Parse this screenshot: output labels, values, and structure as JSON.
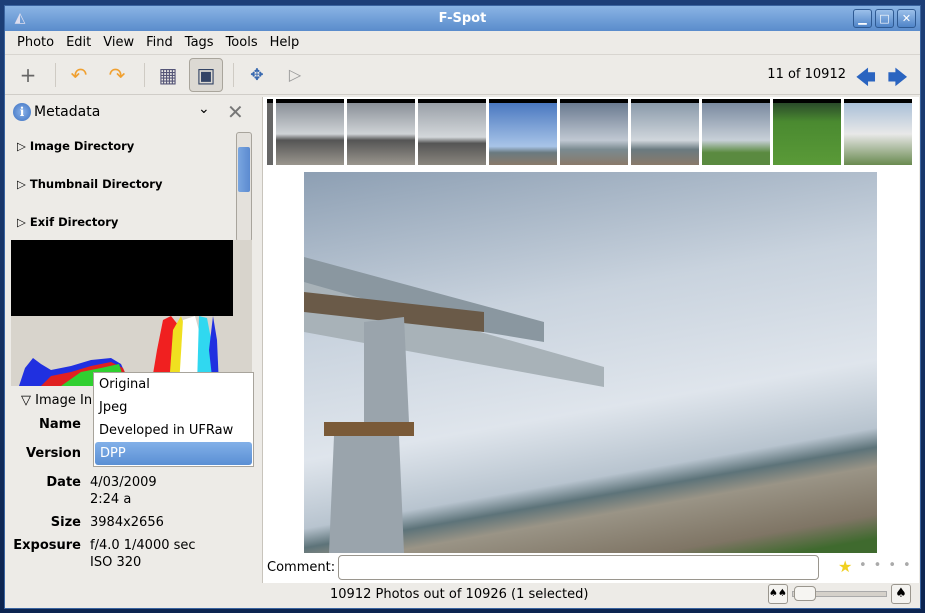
{
  "window": {
    "title": "F-Spot"
  },
  "menu": [
    "Photo",
    "Edit",
    "View",
    "Find",
    "Tags",
    "Tools",
    "Help"
  ],
  "toolbar": {
    "count": "11 of 10912"
  },
  "sidebar": {
    "title": "Metadata",
    "tree": [
      "Image Directory",
      "Thumbnail Directory",
      "Exif Directory"
    ],
    "section": "Image In",
    "props": {
      "name_label": "Name",
      "version_label": "Version",
      "date_label": "Date",
      "date_value": "4/03/2009",
      "time_value": "2:24 a",
      "size_label": "Size",
      "size_value": "3984x2656",
      "exposure_label": "Exposure",
      "exposure_value": "f/4.0 1/4000 sec",
      "iso_value": "ISO 320"
    }
  },
  "version_menu": {
    "options": [
      "Original",
      "Jpeg",
      "Developed in UFRaw",
      "DPP"
    ],
    "selected": "DPP"
  },
  "comment": {
    "label": "Comment:",
    "value": ""
  },
  "rating": {
    "stars": 1,
    "max": 5
  },
  "status": {
    "text": "10912 Photos out of 10926 (1 selected)"
  },
  "colors": {
    "accent": "#5a8fd4",
    "titlebar": "#6f9fd8"
  }
}
